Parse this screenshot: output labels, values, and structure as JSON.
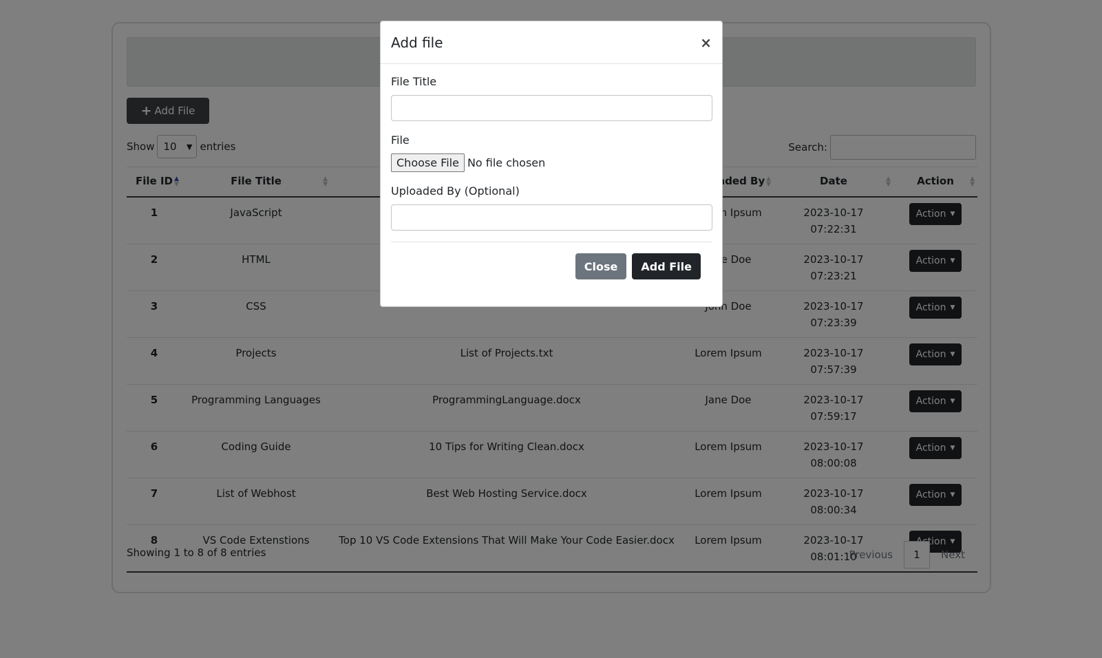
{
  "toolbar": {
    "add_file_label": "Add File",
    "add_icon": "plus-icon"
  },
  "length": {
    "show_label": "Show",
    "value": "10",
    "entries_label": "entries"
  },
  "search": {
    "label": "Search:",
    "value": ""
  },
  "table": {
    "headers": {
      "file_id": "File ID",
      "file_title": "File Title",
      "file_name": "",
      "uploaded_by": "Uploaded By",
      "date": "Date",
      "action": "Action"
    },
    "rows": [
      {
        "id": "1",
        "title": "JavaScript",
        "file": "",
        "uploaded_by": "Lorem Ipsum",
        "date": "2023-10-17 07:22:31",
        "action": "Action"
      },
      {
        "id": "2",
        "title": "HTML",
        "file": "",
        "uploaded_by": "Jane Doe",
        "date": "2023-10-17 07:23:21",
        "action": "Action"
      },
      {
        "id": "3",
        "title": "CSS",
        "file": "",
        "uploaded_by": "John Doe",
        "date": "2023-10-17 07:23:39",
        "action": "Action"
      },
      {
        "id": "4",
        "title": "Projects",
        "file": "List of Projects.txt",
        "uploaded_by": "Lorem Ipsum",
        "date": "2023-10-17 07:57:39",
        "action": "Action"
      },
      {
        "id": "5",
        "title": "Programming Languages",
        "file": "ProgrammingLanguage.docx",
        "uploaded_by": "Jane Doe",
        "date": "2023-10-17 07:59:17",
        "action": "Action"
      },
      {
        "id": "6",
        "title": "Coding Guide",
        "file": "10 Tips for Writing Clean.docx",
        "uploaded_by": "Lorem Ipsum",
        "date": "2023-10-17 08:00:08",
        "action": "Action"
      },
      {
        "id": "7",
        "title": "List of Webhost",
        "file": "Best Web Hosting Service.docx",
        "uploaded_by": "Lorem Ipsum",
        "date": "2023-10-17 08:00:34",
        "action": "Action"
      },
      {
        "id": "8",
        "title": "VS Code Extenstions",
        "file": "Top 10 VS Code Extensions That Will Make Your Code Easier.docx",
        "uploaded_by": "Lorem Ipsum",
        "date": "2023-10-17 08:01:10",
        "action": "Action"
      }
    ]
  },
  "footer": {
    "info": "Showing 1 to 8 of 8 entries",
    "previous": "Previous",
    "page": "1",
    "next": "Next"
  },
  "modal": {
    "title": "Add file",
    "close_symbol": "×",
    "file_title_label": "File Title",
    "file_title_value": "",
    "file_label": "File",
    "choose_file": "Choose File",
    "no_file": "No file chosen",
    "uploaded_by_label": "Uploaded By (Optional)",
    "uploaded_by_value": "",
    "close_button": "Close",
    "add_button": "Add File"
  },
  "colors": {
    "overlay": "#000000",
    "dark_button": "#212529",
    "secondary_button": "#6c757d",
    "sort_active": "#3949ab"
  }
}
